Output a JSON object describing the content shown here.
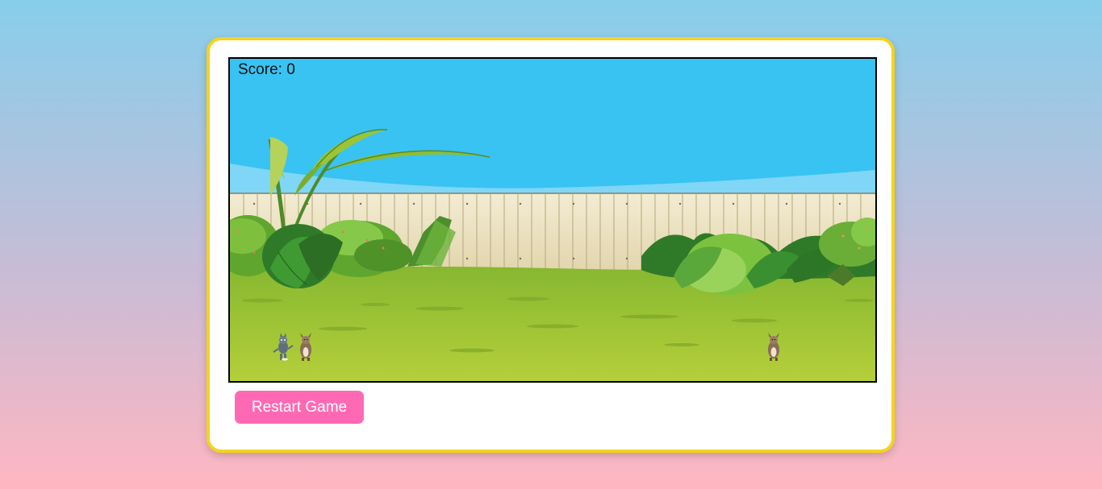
{
  "score": {
    "label": "Score:",
    "value": "0",
    "text": "Score: 0"
  },
  "restart_button": {
    "label": "Restart Game"
  },
  "scene": {
    "sky_color": "#38c3f2",
    "grass_color": "#9cc338",
    "fence_color": "#efe6c6",
    "frame_color": "#f4d41c",
    "button_color": "#ff69b4"
  },
  "characters": [
    {
      "name": "cat-player",
      "icon": "cat-icon"
    },
    {
      "name": "dog-obstacle",
      "icon": "dog-icon"
    },
    {
      "name": "dog-obstacle",
      "icon": "dog-icon"
    }
  ]
}
